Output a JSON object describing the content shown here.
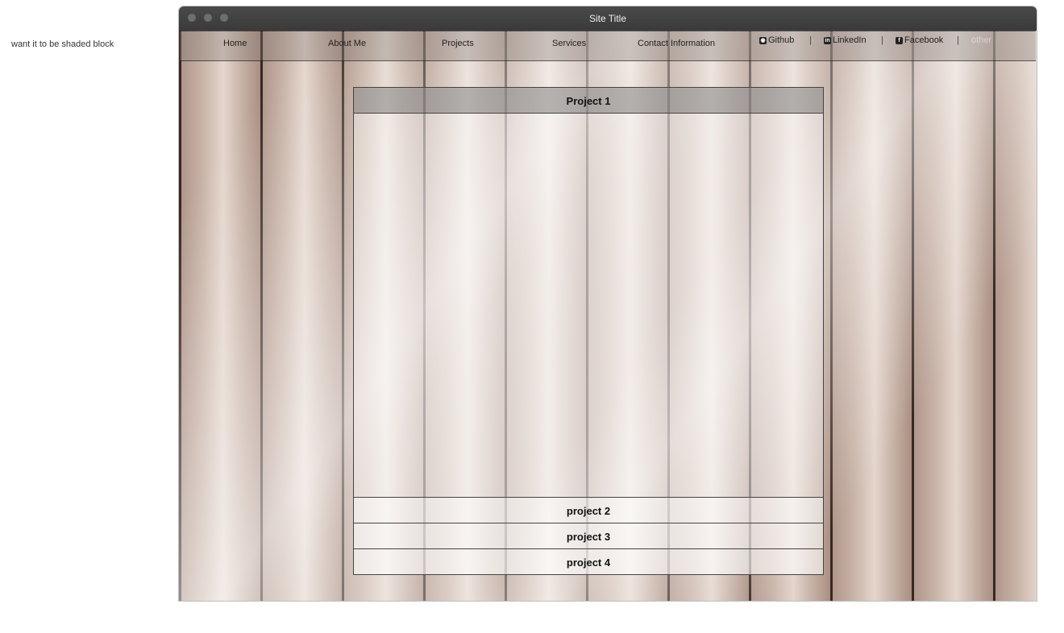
{
  "note": "want it to be shaded block",
  "window": {
    "title": "Site Title"
  },
  "nav": {
    "items": [
      "Home",
      "About Me",
      "Projects",
      "Services",
      "Contact Information"
    ],
    "social": [
      {
        "label": "Github",
        "icon": "github-icon"
      },
      {
        "label": "LinkedIn",
        "icon": "linkedin-icon"
      },
      {
        "label": "Facebook",
        "icon": "facebook-icon"
      }
    ],
    "separator": "|",
    "overflow_label": "other"
  },
  "accordion": {
    "active": "Project 1",
    "items": [
      "project 2",
      "project 3",
      "project 4"
    ]
  }
}
